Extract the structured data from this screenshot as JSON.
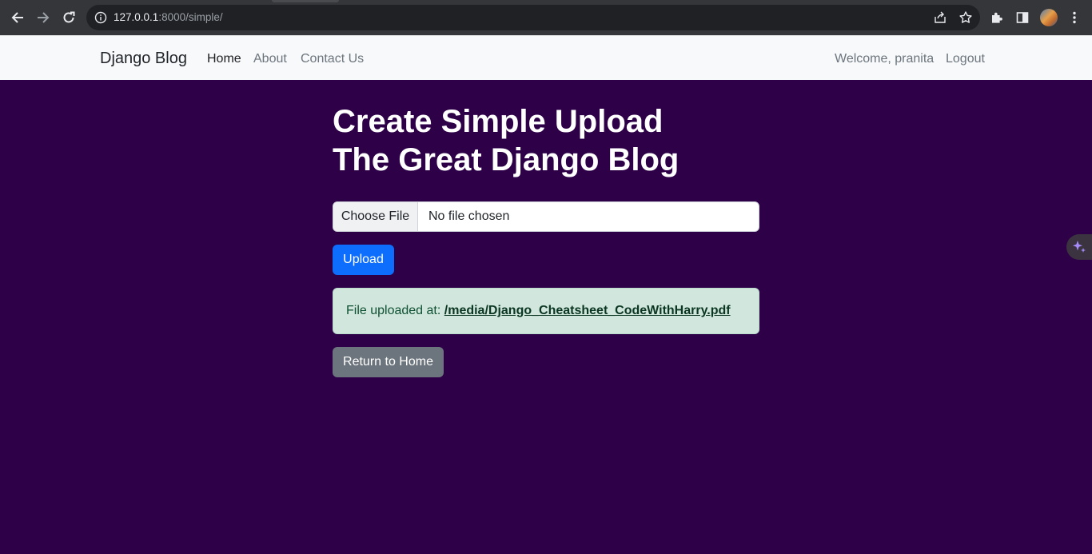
{
  "browser": {
    "url_host": "127.0.0.1",
    "url_rest": ":8000/simple/"
  },
  "navbar": {
    "brand": "Django Blog",
    "links": [
      {
        "label": "Home"
      },
      {
        "label": "About"
      },
      {
        "label": "Contact Us"
      }
    ],
    "welcome": "Welcome, pranita",
    "logout": "Logout"
  },
  "main": {
    "title_line1": "Create Simple Upload",
    "title_line2": "The Great Django Blog",
    "file_input": {
      "button_label": "Choose File",
      "status": "No file chosen"
    },
    "upload_label": "Upload",
    "alert": {
      "prefix": "File uploaded at:",
      "link": "/media/Django_Cheatsheet_CodeWithHarry.pdf"
    },
    "return_label": "Return to Home"
  },
  "colors": {
    "page_bg": "#2d0047",
    "primary": "#0d6efd",
    "secondary": "#6c757d",
    "alert_bg": "#d1e7dd"
  }
}
